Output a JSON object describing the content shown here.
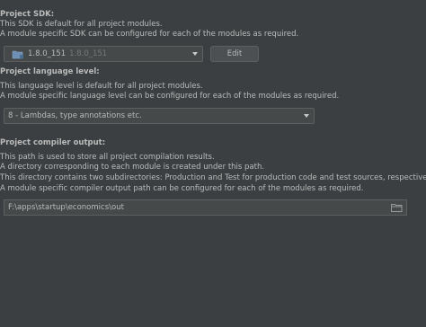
{
  "sdk": {
    "title": "Project SDK:",
    "desc_line1": "This SDK is default for all project modules.",
    "desc_line2": "A module specific SDK can be configured for each of the modules as required.",
    "selected_name": "1.8.0_151",
    "selected_version": "1.8.0_151",
    "edit_label": "Edit"
  },
  "language": {
    "title": "Project language level:",
    "desc_line1": "This language level is default for all project modules.",
    "desc_line2": "A module specific language level can be configured for each of the modules as required.",
    "selected": "8 - Lambdas, type annotations etc."
  },
  "compiler": {
    "title": "Project compiler output:",
    "desc_line1": "This path is used to store all project compilation results.",
    "desc_line2": "A directory corresponding to each module is created under this path.",
    "desc_line3": "This directory contains two subdirectories: Production and Test for production code and test sources, respectively.",
    "desc_line4": "A module specific compiler output path can be configured for each of the modules as required.",
    "path": "F:\\apps\\startup\\economics\\out"
  },
  "colors": {
    "background": "#3c3f41",
    "text": "#bbbbbb",
    "field": "#45494a",
    "border": "#5e6060"
  }
}
